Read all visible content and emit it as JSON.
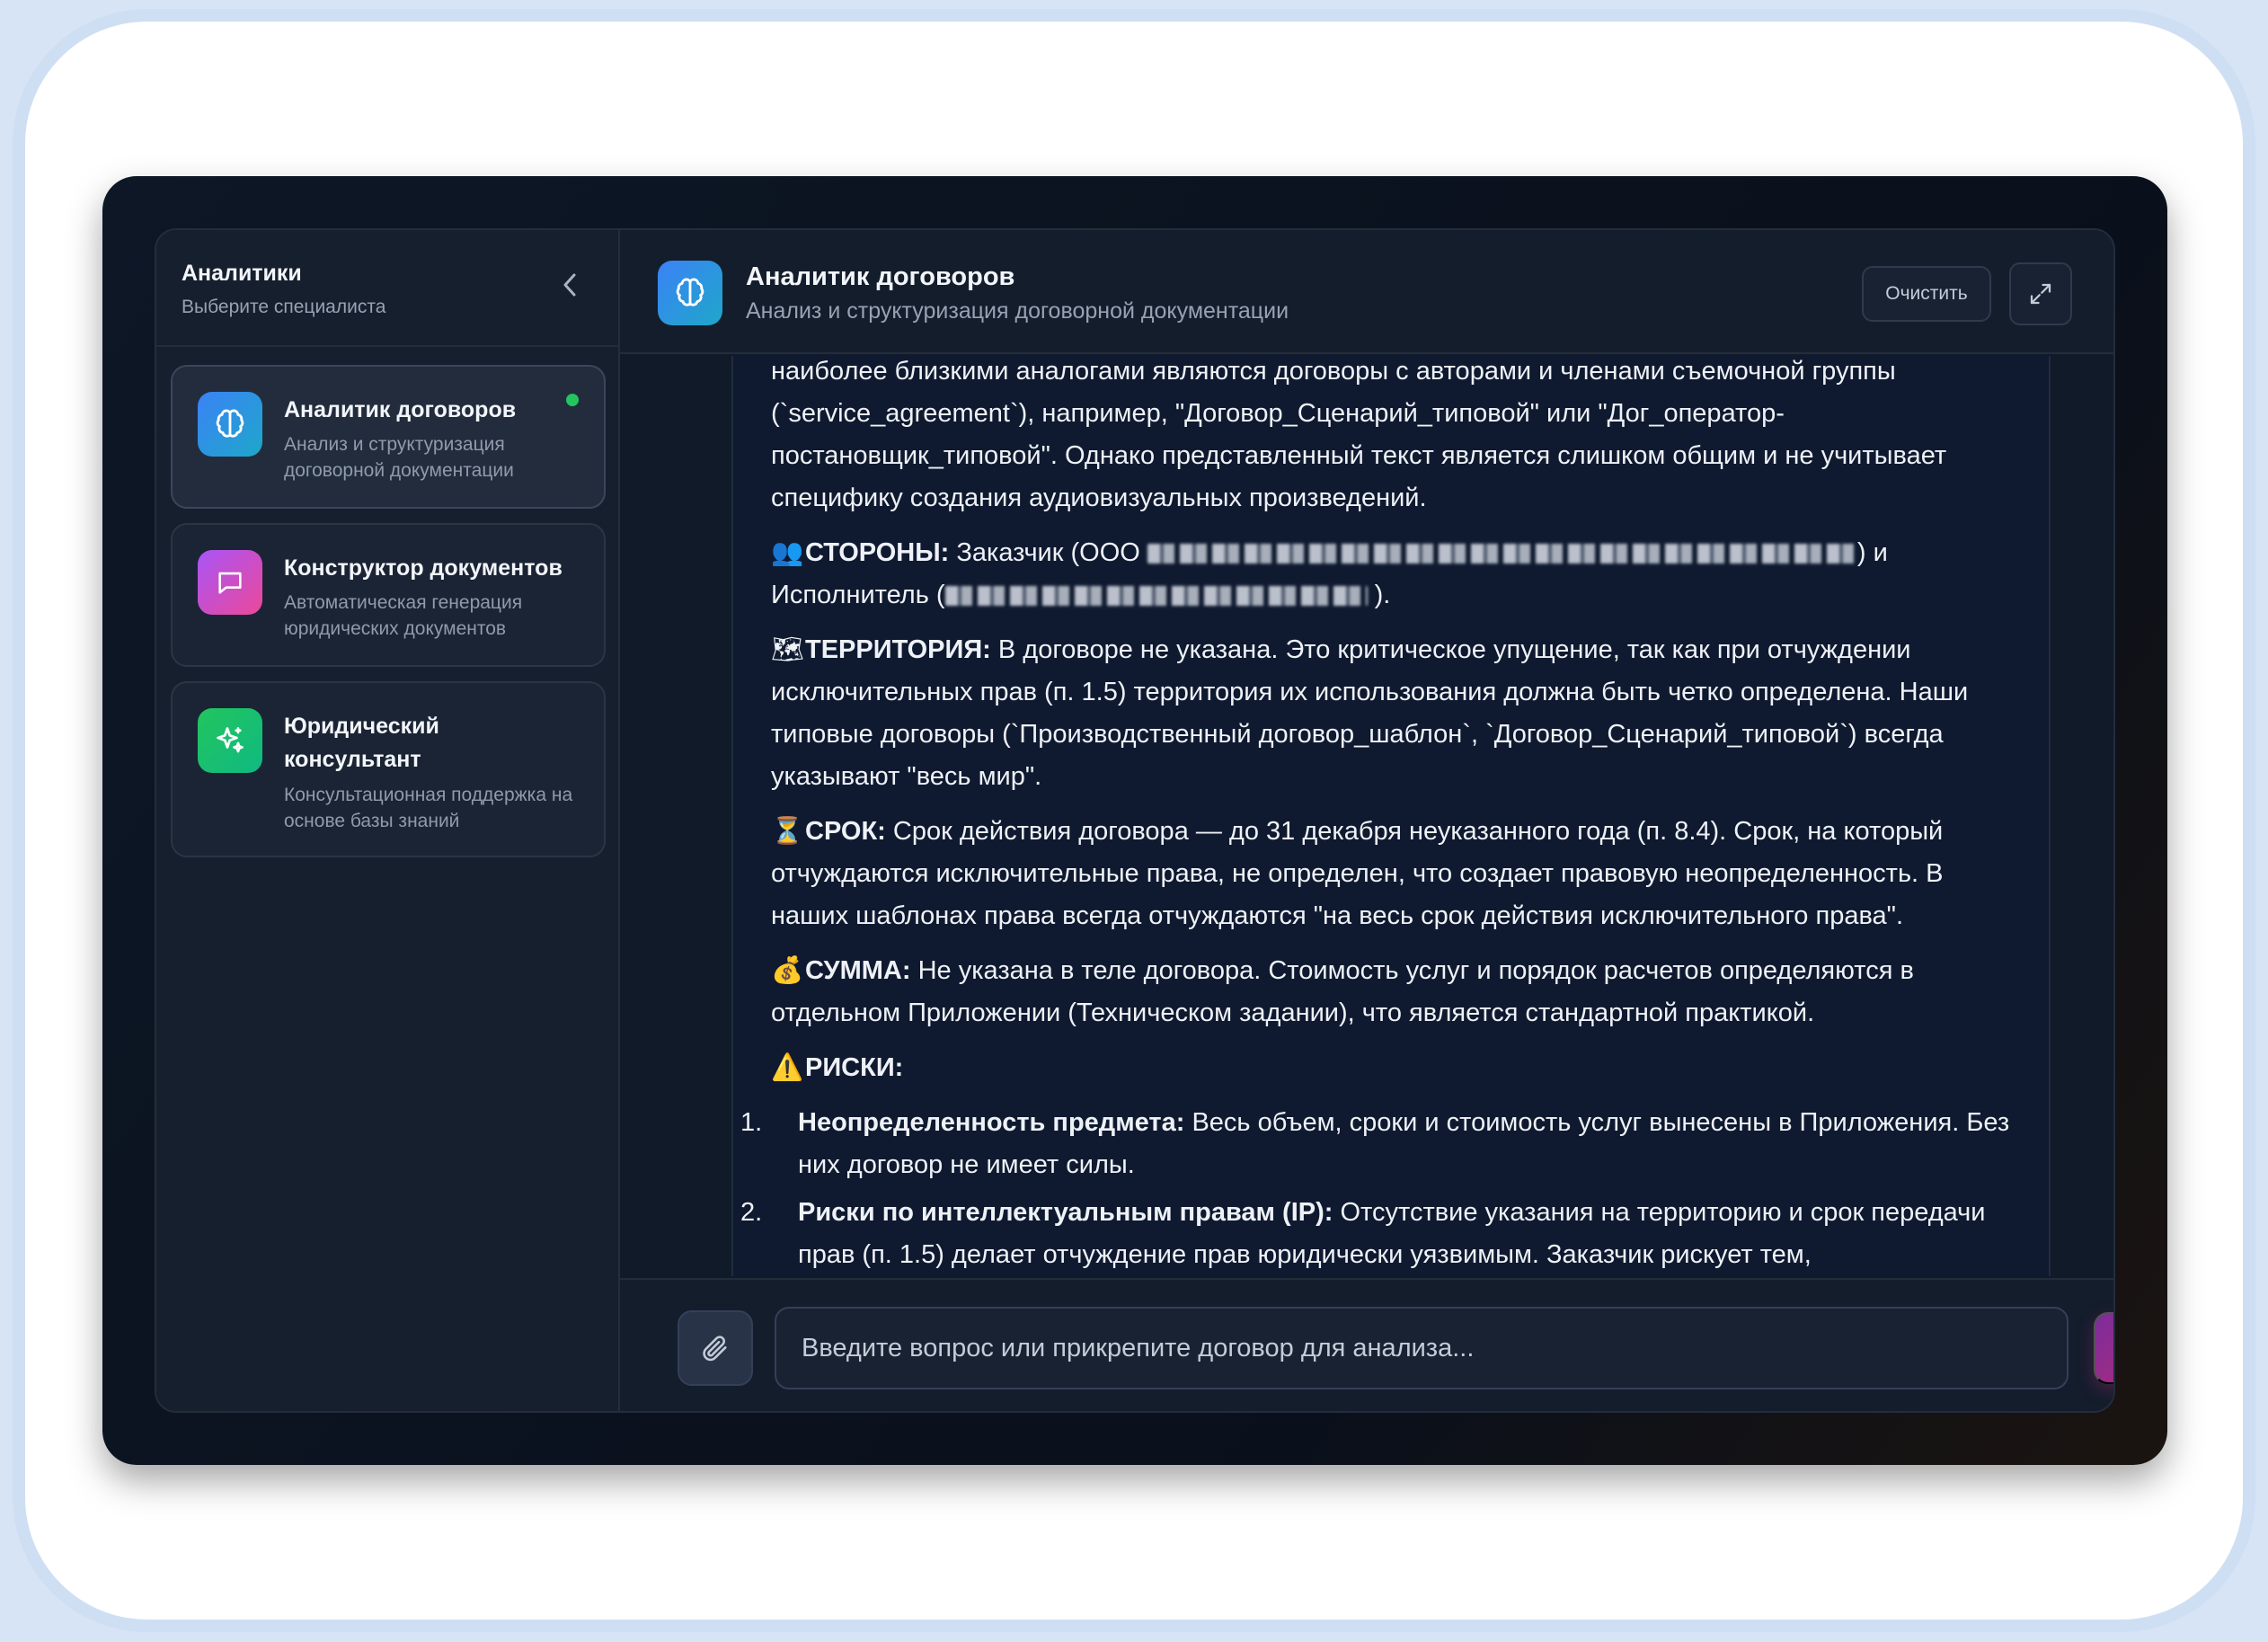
{
  "sidebar": {
    "title": "Аналитики",
    "subtitle": "Выберите специалиста",
    "agents": [
      {
        "name": "Аналитик договоров",
        "desc": "Анализ и структуризация договорной документации",
        "icon": "brain-icon",
        "color": "#3b82f6",
        "active": true
      },
      {
        "name": "Конструктор документов",
        "desc": "Автоматическая генерация юридических документов",
        "icon": "chat-icon",
        "color": "#c026d3"
      },
      {
        "name": "Юридический консультант",
        "desc": "Консультационная поддержка на основе базы знаний",
        "icon": "sparkles-icon",
        "color": "#22c55e"
      }
    ]
  },
  "header": {
    "title": "Аналитик договоров",
    "subtitle": "Анализ и структуризация договорной документации",
    "clear_label": "Очистить"
  },
  "message": {
    "intro": "наиболее близкими аналогами являются договоры с авторами и членами съемочной группы (`service_agreement`), например, \"Договор_Сценарий_типовой\" или \"Дог_оператор-постановщик_типовой\". Однако представленный текст является слишком общим и не учитывает специфику создания аудиовизуальных произведений.",
    "parties_label": "СТОРОНЫ:",
    "parties_text_1": "Заказчик (ООО",
    "parties_text_2": ") и Исполнитель (",
    "parties_text_3": ").",
    "territory_label": "ТЕРРИТОРИЯ:",
    "territory_text": "В договоре не указана. Это критическое упущение, так как при отчуждении исключительных прав (п. 1.5) территория их использования должна быть четко определена. Наши типовые договоры (`Производственный договор_шаблон`, `Договор_Сценарий_типовой`) всегда указывают \"весь мир\".",
    "term_label": "СРОК:",
    "term_text": "Срок действия договора — до 31 декабря неуказанного года (п. 8.4). Срок, на который отчуждаются исключительные права, не определен, что создает правовую неопределенность. В наших шаблонах права всегда отчуждаются \"на весь срок действия исключительного права\".",
    "sum_label": "СУММА:",
    "sum_text": "Не указана в теле договора. Стоимость услуг и порядок расчетов определяются в отдельном Приложении (Техническом задании), что является стандартной практикой.",
    "risks_label": "РИСКИ:",
    "risks": [
      {
        "num": "1.",
        "title": "Неопределенность предмета:",
        "text": "Весь объем, сроки и стоимость услуг вынесены в Приложения. Без них договор не имеет силы."
      },
      {
        "num": "2.",
        "title": "Риски по интеллектуальным правам (IP):",
        "text": "Отсутствие указания на территорию и срок передачи прав (п. 1.5) делает отчуждение прав юридически уязвимым. Заказчик рискует тем,"
      }
    ]
  },
  "composer": {
    "placeholder": "Введите вопрос или прикрепите договор для анализа..."
  },
  "colors": {
    "accent": "#3b82f6",
    "online": "#22c55e",
    "send": "#b02a78"
  }
}
